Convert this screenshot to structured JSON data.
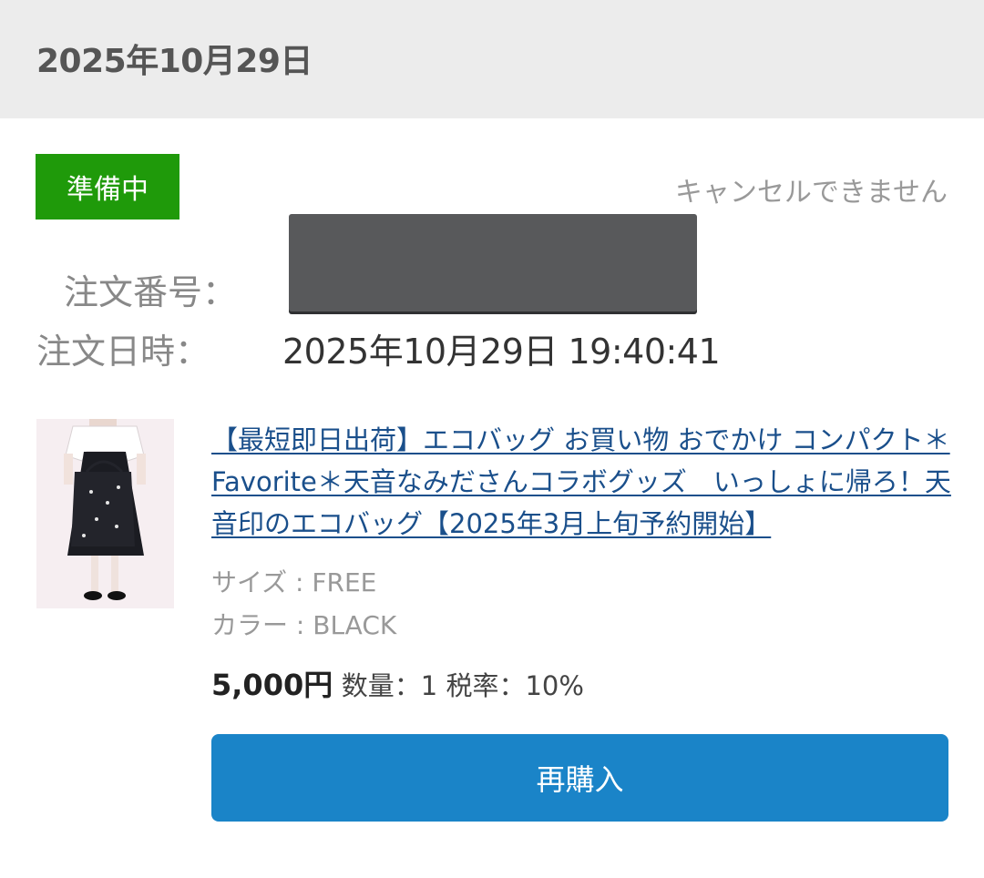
{
  "header": {
    "date": "2025年10月29日"
  },
  "order": {
    "status": "準備中",
    "cancel_note": "キャンセルできません",
    "order_number_label": "注文番号：",
    "order_datetime_label": "注文日時：",
    "order_datetime_value": "2025年10月29日 19:40:41"
  },
  "item": {
    "title": "【最短即日出荷】エコバッグ お買い物 おでかけ コンパクト＊Favorite＊天音なみださんコラボグッズ　いっしょに帰ろ！天音印のエコバッグ【2025年3月上旬予約開始】",
    "size": "サイズ : FREE",
    "color": "カラー : BLACK",
    "price": "5,000円",
    "qty_tax": "数量：1 税率：10%"
  },
  "actions": {
    "rebuy_label": "再購入"
  },
  "colors": {
    "status_badge": "#1f9a0a",
    "link": "#1a4f8b",
    "button": "#1a84c8",
    "header_bg": "#ececec"
  }
}
